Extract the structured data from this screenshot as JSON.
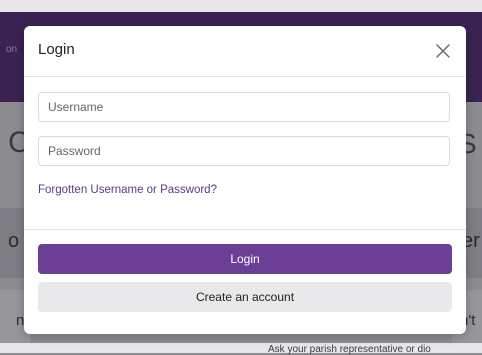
{
  "background": {
    "nav_text": "on",
    "heading_left": "C",
    "heading_right": "S",
    "subheading_left": "o",
    "subheading_right": "er",
    "text_left": "n a",
    "text_right": "n't",
    "footer_text": "Ask your parish representative or dio"
  },
  "modal": {
    "title": "Login",
    "close_icon": "close-icon",
    "username_placeholder": "Username",
    "password_placeholder": "Password",
    "forgot_link": "Forgotten Username or Password?",
    "login_button": "Login",
    "create_account_button": "Create an account"
  },
  "colors": {
    "primary": "#6b3f96",
    "link": "#5b3a8c",
    "secondary_button": "#e9e9ec",
    "backdrop": "#8d8c91"
  }
}
